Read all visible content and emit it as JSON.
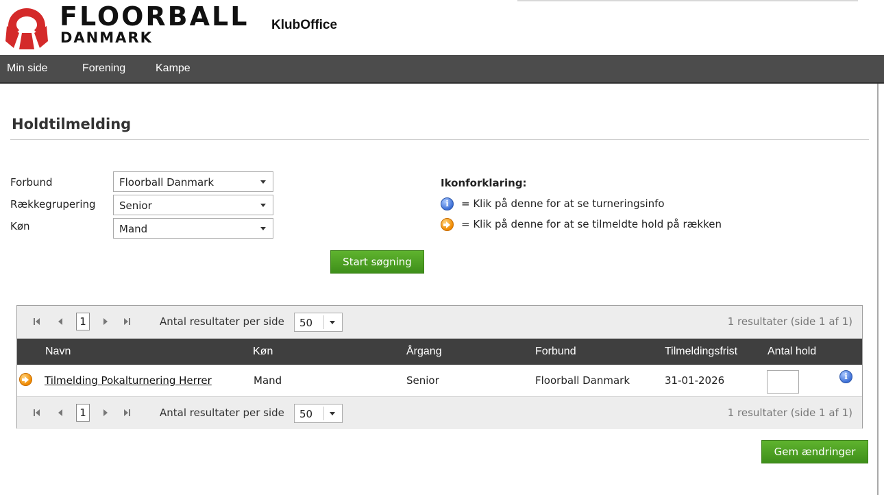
{
  "header": {
    "brand_line1": "FLOORBALL",
    "brand_line2": "DANMARK",
    "app_name": "KlubOffice",
    "logo_icon": "floorball-danmark-logo"
  },
  "nav": {
    "items": [
      {
        "label": "Min side"
      },
      {
        "label": "Forening"
      },
      {
        "label": "Kampe"
      }
    ]
  },
  "page": {
    "title": "Holdtilmelding"
  },
  "filters": {
    "forbund_label": "Forbund",
    "forbund_value": "Floorball Danmark",
    "raekke_label": "Rækkegrupering",
    "raekke_value": "Senior",
    "koen_label": "Køn",
    "koen_value": "Mand",
    "search_button": "Start søgning"
  },
  "legend": {
    "title": "Ikonforklaring:",
    "info_text": "= Klik på denne for at se turneringsinfo",
    "arrow_text": "= Klik på denne for at se tilmeldte hold på rækken"
  },
  "grid": {
    "pager": {
      "page": "1",
      "per_page_label": "Antal resultater per side",
      "per_page_value": "50",
      "info": "1 resultater (side 1 af 1)"
    },
    "columns": {
      "navn": "Navn",
      "koen": "Køn",
      "aargang": "Årgang",
      "forbund": "Forbund",
      "frist": "Tilmeldingsfrist",
      "antal": "Antal hold"
    },
    "rows": [
      {
        "navn": "Tilmelding Pokalturnering Herrer",
        "koen": "Mand",
        "aargang": "Senior",
        "forbund": "Floorball Danmark",
        "frist": "31-01-2026",
        "antal": ""
      }
    ]
  },
  "actions": {
    "save_button": "Gem ændringer"
  },
  "colors": {
    "nav_bg": "#4c4c4c",
    "grid_header_bg": "#3f3f3f",
    "button_green": "#4ea124",
    "logo_red": "#d42a2a"
  }
}
